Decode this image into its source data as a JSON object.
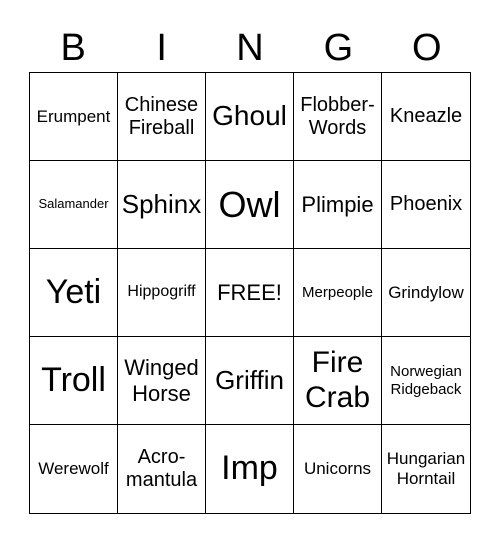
{
  "header": [
    "B",
    "I",
    "N",
    "G",
    "O"
  ],
  "cells": [
    "Erumpent",
    "Chinese Fireball",
    "Ghoul",
    "Flobber-Words",
    "Kneazle",
    "Salamander",
    "Sphinx",
    "Owl",
    "Plimpie",
    "Phoenix",
    "Yeti",
    "Hippogriff",
    "FREE!",
    "Merpeople",
    "Grindylow",
    "Troll",
    "Winged Horse",
    "Griffin",
    "Fire Crab",
    "Norwegian Ridgeback",
    "Werewolf",
    "Acro-mantula",
    "Imp",
    "Unicorns",
    "Hungarian Horntail"
  ]
}
